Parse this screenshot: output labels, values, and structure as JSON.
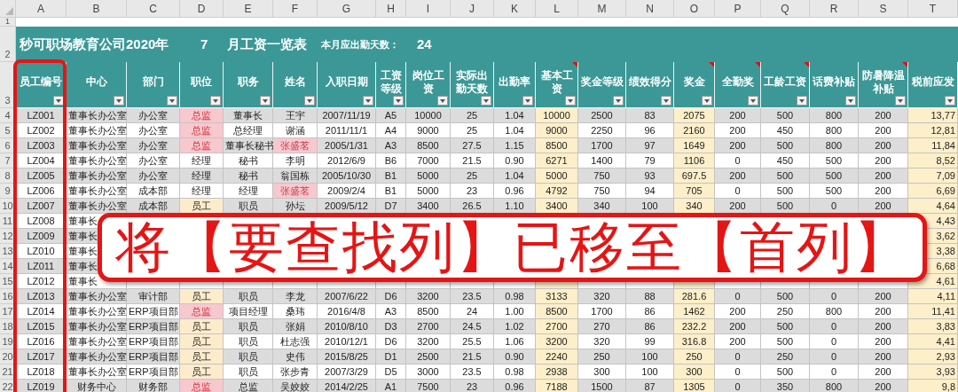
{
  "column_letters": [
    "A",
    "B",
    "C",
    "D",
    "E",
    "F",
    "G",
    "H",
    "I",
    "J",
    "K",
    "L",
    "M",
    "N",
    "O",
    "P",
    "Q",
    "R",
    "S",
    "T"
  ],
  "header_row_numbers": [
    "1",
    "2",
    "3"
  ],
  "title": {
    "company": "秒可职场教育公司2020年",
    "month": "7",
    "suffix": "月工资一览表",
    "days_label": "本月应出勤天数：",
    "days": "24"
  },
  "columns": [
    {
      "label": "员工编号",
      "highlight": false,
      "comment": false
    },
    {
      "label": "中心",
      "highlight": false,
      "comment": false
    },
    {
      "label": "部门",
      "highlight": false,
      "comment": false
    },
    {
      "label": "职位",
      "highlight": false,
      "comment": false
    },
    {
      "label": "职务",
      "highlight": false,
      "comment": false
    },
    {
      "label": "姓名",
      "highlight": false,
      "comment": false
    },
    {
      "label": "入职日期",
      "highlight": false,
      "comment": false
    },
    {
      "label": "工资等级",
      "highlight": false,
      "comment": false
    },
    {
      "label": "岗位工资",
      "highlight": false,
      "comment": false
    },
    {
      "label": "实际出勤天数",
      "highlight": false,
      "comment": false
    },
    {
      "label": "出勤率",
      "highlight": false,
      "comment": false
    },
    {
      "label": "基本工资",
      "highlight": true,
      "comment": true
    },
    {
      "label": "奖金等级",
      "highlight": false,
      "comment": false
    },
    {
      "label": "绩效得分",
      "highlight": false,
      "comment": false
    },
    {
      "label": "奖金",
      "highlight": true,
      "comment": true
    },
    {
      "label": "全勤奖",
      "highlight": false,
      "comment": true
    },
    {
      "label": "工龄工资",
      "highlight": false,
      "comment": true
    },
    {
      "label": "话费补贴",
      "highlight": false,
      "comment": false
    },
    {
      "label": "防暑降温补贴",
      "highlight": false,
      "comment": true
    },
    {
      "label": "税前应发",
      "highlight": true,
      "comment": false
    }
  ],
  "rows": [
    {
      "row_number": "4",
      "kind": "full",
      "position_alert": true,
      "position_staff": false,
      "name_flag": false,
      "cells": [
        "LZ001",
        "董事长办公室",
        "办公室",
        "总监",
        "董事长",
        "王宇",
        "2007/11/19",
        "A5",
        "10000",
        "25",
        "1.04",
        "10000",
        "2500",
        "83",
        "2075",
        "200",
        "500",
        "800",
        "200",
        "13,77"
      ]
    },
    {
      "row_number": "5",
      "kind": "full",
      "position_alert": true,
      "position_staff": false,
      "name_flag": false,
      "cells": [
        "LZ002",
        "董事长办公室",
        "办公室",
        "总监",
        "总经理",
        "谢涵",
        "2011/11/1",
        "A4",
        "9000",
        "25",
        "1.04",
        "9000",
        "2250",
        "96",
        "2160",
        "200",
        "450",
        "800",
        "200",
        "12,81"
      ]
    },
    {
      "row_number": "6",
      "kind": "full",
      "position_alert": true,
      "position_staff": false,
      "name_flag": true,
      "cells": [
        "LZ003",
        "董事长办公室",
        "办公室",
        "总监",
        "董事长秘书",
        "张盛茗",
        "2005/1/31",
        "A3",
        "8500",
        "27.5",
        "1.15",
        "8500",
        "1700",
        "97",
        "1649",
        "200",
        "500",
        "800",
        "200",
        "11,84"
      ]
    },
    {
      "row_number": "7",
      "kind": "full",
      "position_alert": false,
      "position_staff": false,
      "name_flag": false,
      "cells": [
        "LZ004",
        "董事长办公室",
        "办公室",
        "经理",
        "秘书",
        "李明",
        "2012/6/9",
        "B6",
        "7000",
        "21.5",
        "0.90",
        "6271",
        "1400",
        "79",
        "1106",
        "0",
        "450",
        "500",
        "200",
        "8,52"
      ]
    },
    {
      "row_number": "8",
      "kind": "full",
      "position_alert": false,
      "position_staff": false,
      "name_flag": false,
      "cells": [
        "LZ005",
        "董事长办公室",
        "办公室",
        "经理",
        "秘书",
        "翁国栋",
        "2005/10/30",
        "B1",
        "5000",
        "25",
        "1.04",
        "5000",
        "750",
        "93",
        "697.5",
        "200",
        "500",
        "500",
        "200",
        "7,09"
      ]
    },
    {
      "row_number": "9",
      "kind": "full",
      "position_alert": false,
      "position_staff": false,
      "name_flag": true,
      "cells": [
        "LZ006",
        "董事长办公室",
        "成本部",
        "经理",
        "经理",
        "张盛茗",
        "2009/2/4",
        "B1",
        "5000",
        "23",
        "0.96",
        "4792",
        "750",
        "94",
        "705",
        "0",
        "500",
        "500",
        "200",
        "6,69"
      ]
    },
    {
      "row_number": "10",
      "kind": "full",
      "position_alert": false,
      "position_staff": true,
      "name_flag": false,
      "cells": [
        "LZ007",
        "董事长办公室",
        "成本部",
        "员工",
        "职员",
        "孙坛",
        "2009/5/12",
        "D7",
        "3400",
        "26.5",
        "1.10",
        "3400",
        "340",
        "100",
        "340",
        "200",
        "500",
        "0",
        "200",
        "4,64"
      ]
    },
    {
      "row_number": "11",
      "kind": "covered",
      "cells": [
        "LZ008",
        "董事长",
        "4,43"
      ]
    },
    {
      "row_number": "12",
      "kind": "covered",
      "cells": [
        "LZ009",
        "董事长",
        "3,62"
      ]
    },
    {
      "row_number": "13",
      "kind": "covered",
      "cells": [
        "LZ010",
        "董事长",
        "3,38"
      ]
    },
    {
      "row_number": "14",
      "kind": "covered",
      "cells": [
        "LZ011",
        "董事长",
        "6,68"
      ]
    },
    {
      "row_number": "15",
      "kind": "covered",
      "cells": [
        "LZ012",
        "董事长",
        "4,61"
      ]
    },
    {
      "row_number": "16",
      "kind": "full",
      "position_alert": false,
      "position_staff": true,
      "name_flag": false,
      "cells": [
        "LZ013",
        "董事长办公室",
        "审计部",
        "员工",
        "职员",
        "李龙",
        "2007/6/22",
        "D6",
        "3200",
        "23.5",
        "0.98",
        "3133",
        "320",
        "88",
        "281.6",
        "0",
        "500",
        "0",
        "200",
        "4,11"
      ]
    },
    {
      "row_number": "17",
      "kind": "full",
      "position_alert": true,
      "position_staff": false,
      "name_flag": false,
      "cells": [
        "LZ014",
        "董事长办公室",
        "ERP项目部",
        "总监",
        "项目经理",
        "桑玮",
        "2016/4/8",
        "A3",
        "8500",
        "24",
        "1.00",
        "8500",
        "1700",
        "86",
        "1462",
        "200",
        "250",
        "800",
        "200",
        "11,41"
      ]
    },
    {
      "row_number": "18",
      "kind": "full",
      "position_alert": false,
      "position_staff": true,
      "name_flag": false,
      "cells": [
        "LZ015",
        "董事长办公室",
        "ERP项目部",
        "员工",
        "职员",
        "张娟",
        "2010/8/10",
        "D3",
        "2700",
        "24.5",
        "1.02",
        "2700",
        "270",
        "86",
        "232.2",
        "200",
        "500",
        "0",
        "200",
        "3,83"
      ]
    },
    {
      "row_number": "19",
      "kind": "full",
      "position_alert": false,
      "position_staff": true,
      "name_flag": false,
      "cells": [
        "LZ016",
        "董事长办公室",
        "ERP项目部",
        "员工",
        "职员",
        "杜志强",
        "2010/12/1",
        "D6",
        "3200",
        "25.5",
        "1.06",
        "3200",
        "320",
        "99",
        "316.8",
        "200",
        "500",
        "0",
        "200",
        "4,41"
      ]
    },
    {
      "row_number": "20",
      "kind": "full",
      "position_alert": false,
      "position_staff": true,
      "name_flag": false,
      "cells": [
        "LZ017",
        "董事长办公室",
        "ERP项目部",
        "员工",
        "职员",
        "史伟",
        "2015/8/25",
        "D1",
        "2500",
        "21.5",
        "0.90",
        "2240",
        "250",
        "100",
        "250",
        "0",
        "250",
        "0",
        "200",
        "2,93"
      ]
    },
    {
      "row_number": "21",
      "kind": "full",
      "position_alert": false,
      "position_staff": true,
      "name_flag": false,
      "cells": [
        "LZ018",
        "董事长办公室",
        "ERP项目部",
        "员工",
        "职员",
        "张步青",
        "2007/3/29",
        "D5",
        "3000",
        "23.5",
        "0.98",
        "2938",
        "300",
        "100",
        "300",
        "0",
        "500",
        "0",
        "200",
        "3,93"
      ]
    },
    {
      "row_number": "22",
      "kind": "full",
      "position_alert": true,
      "position_staff": false,
      "name_flag": false,
      "cells": [
        "LZ019",
        "财务中心",
        "财务部",
        "总监",
        "总监",
        "吴姣姣",
        "2014/2/25",
        "A1",
        "7500",
        "23",
        "0.96",
        "7188",
        "1500",
        "87",
        "1305",
        "0",
        "350",
        "800",
        "200",
        "9,8"
      ]
    }
  ],
  "banner": "将【要查找列】已移至【首列】"
}
